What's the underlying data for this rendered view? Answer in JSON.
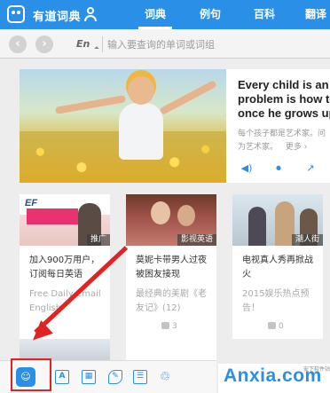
{
  "app": {
    "name": "有道词典"
  },
  "header": {
    "tabs": [
      {
        "label": "词典",
        "active": true
      },
      {
        "label": "例句",
        "active": false
      },
      {
        "label": "百科",
        "active": false
      },
      {
        "label": "翻译",
        "active": false
      }
    ]
  },
  "search": {
    "back_icon": "left-arrow-icon",
    "forward_icon": "right-arrow-icon",
    "language": "En",
    "placeholder": "输入要查询的单词或词组"
  },
  "feature": {
    "headline_lines": [
      "Every child is an a",
      "problem is how to",
      "once he grows up"
    ],
    "summary_lines": [
      "每个孩子都是艺术家。问",
      "为艺术家。"
    ],
    "more_label": "更多 ›",
    "actions": [
      "speaker-icon",
      "microphone-icon",
      "share-icon"
    ]
  },
  "cards": [
    {
      "image_brand": "EF",
      "image_tag": "推广",
      "title": "加入900万用户，订阅每日英语",
      "desc": "Free Daily Email English"
    },
    {
      "image_tag": "影视英语",
      "title": "莫妮卡带男人过夜被困友接现",
      "desc": "最经典的美剧《老友记》(12)",
      "likes": "3"
    },
    {
      "image_tag": "潮人街",
      "title": "电视真人秀再掀战火",
      "desc": "2015娱乐热点预告！",
      "likes": "0"
    }
  ],
  "bottom_bar": {
    "icons": [
      "dictionary-app-icon",
      "word-book-icon",
      "picture-icon",
      "note-icon",
      "card-icon",
      "recycle-icon"
    ]
  },
  "watermark": {
    "main": "Anxia.com",
    "sub": "安下软件站"
  },
  "colors": {
    "brand_blue": "#2a8fe6",
    "highlight_red": "#e02424"
  }
}
